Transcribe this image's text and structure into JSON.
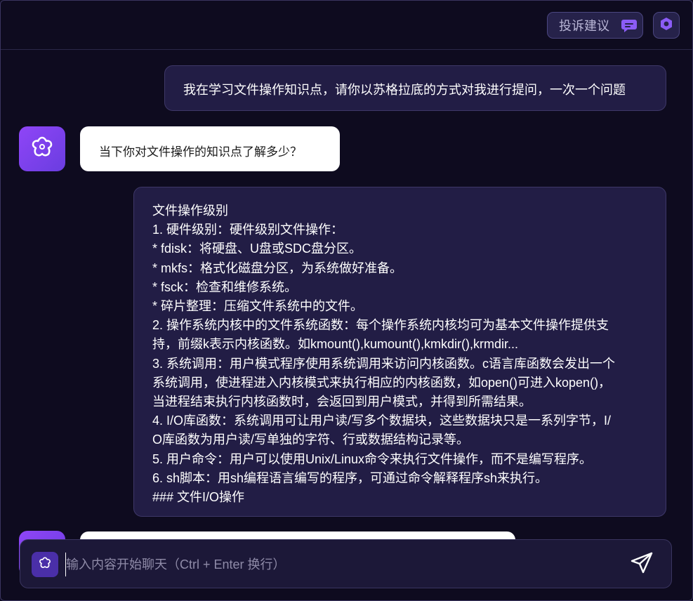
{
  "header": {
    "complain_label": "投诉建议",
    "complain_icon": "feedback-icon",
    "settings_icon": "hexagon-settings-icon",
    "accent": "#8b5cf6"
  },
  "messages": [
    {
      "role": "user",
      "text": "我在学习文件操作知识点，请你以苏格拉底的方式对我进行提问，一次一个问题"
    },
    {
      "role": "bot",
      "avatar_icon": "flower-icon",
      "text": "当下你对文件操作的知识点了解多少？"
    },
    {
      "role": "user",
      "lines": [
        "文件操作级别",
        "1. 硬件级别：硬件级别文件操作：",
        "* fdisk：将硬盘、U盘或SDC盘分区。",
        "* mkfs：格式化磁盘分区，为系统做好准备。",
        "* fsck：检查和维修系统。",
        "* 碎片整理：压缩文件系统中的文件。",
        "2. 操作系统内核中的文件系统函数：每个操作系统内核均可为基本文件操作提供支",
        "持，前缀k表示内核函数。如kmount(),kumount(),kmkdir(),krmdir...",
        "3. 系统调用：用户模式程序使用系统调用来访问内核函数。c语言库函数会发出一个",
        "系统调用，使进程进入内核模式来执行相应的内核函数，如open()可进入kopen()，",
        "当进程结束执行内核函数时，会返回到用户模式，并得到所需结果。",
        "4. I/O库函数：系统调用可让用户读/写多个数据块，这些数据块只是一系列字节，I/",
        "O库函数为用户读/写单独的字符、行或数据结构记录等。",
        "5. 用户命令：用户可以使用Unix/Linux命令来执行文件操作，而不是编写程序。",
        "6. sh脚本：用sh编程语言编写的程序，可通过命令解释程序sh来执行。",
        "### 文件I/O操作"
      ]
    },
    {
      "role": "bot",
      "avatar_icon": "flower-icon",
      "text": ""
    }
  ],
  "composer": {
    "placeholder": "输入内容开始聊天（Ctrl + Enter 换行）",
    "value": "",
    "plugin_icon": "flower-icon",
    "send_icon": "send-icon"
  }
}
